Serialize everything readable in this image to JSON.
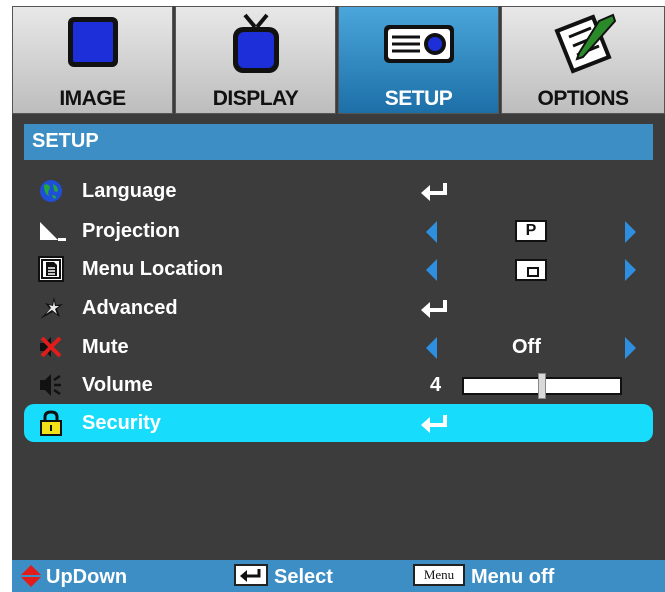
{
  "tabs": [
    {
      "label": "IMAGE",
      "icon": "monitor-icon",
      "active": false
    },
    {
      "label": "DISPLAY",
      "icon": "tv-icon",
      "active": false
    },
    {
      "label": "SETUP",
      "icon": "projector-icon",
      "active": true
    },
    {
      "label": "OPTIONS",
      "icon": "notepad-icon",
      "active": false
    }
  ],
  "section": {
    "title": "SETUP"
  },
  "menu": {
    "language": {
      "label": "Language",
      "icon": "globe-icon"
    },
    "projection": {
      "label": "Projection",
      "icon": "projection-icon",
      "value": "P"
    },
    "menu_location": {
      "label": "Menu Location",
      "icon": "document-icon",
      "value": "▫"
    },
    "advanced": {
      "label": "Advanced",
      "icon": "sparkle-icon"
    },
    "mute": {
      "label": "Mute",
      "icon": "mute-icon",
      "value": "Off"
    },
    "volume": {
      "label": "Volume",
      "icon": "speaker-icon",
      "value": "4",
      "level_fraction": 0.5
    },
    "security": {
      "label": "Security",
      "icon": "lock-icon",
      "selected": true
    }
  },
  "footer": {
    "updown": "UpDown",
    "select": "Select",
    "menu_key": "Menu",
    "menu_off": "Menu off"
  },
  "colors": {
    "background": "#3c3c3c",
    "accent": "#3d8ec4",
    "active_tab": "#2a86c4",
    "selected_row": "#18dcfb",
    "arrow": "#2e8fe0"
  }
}
